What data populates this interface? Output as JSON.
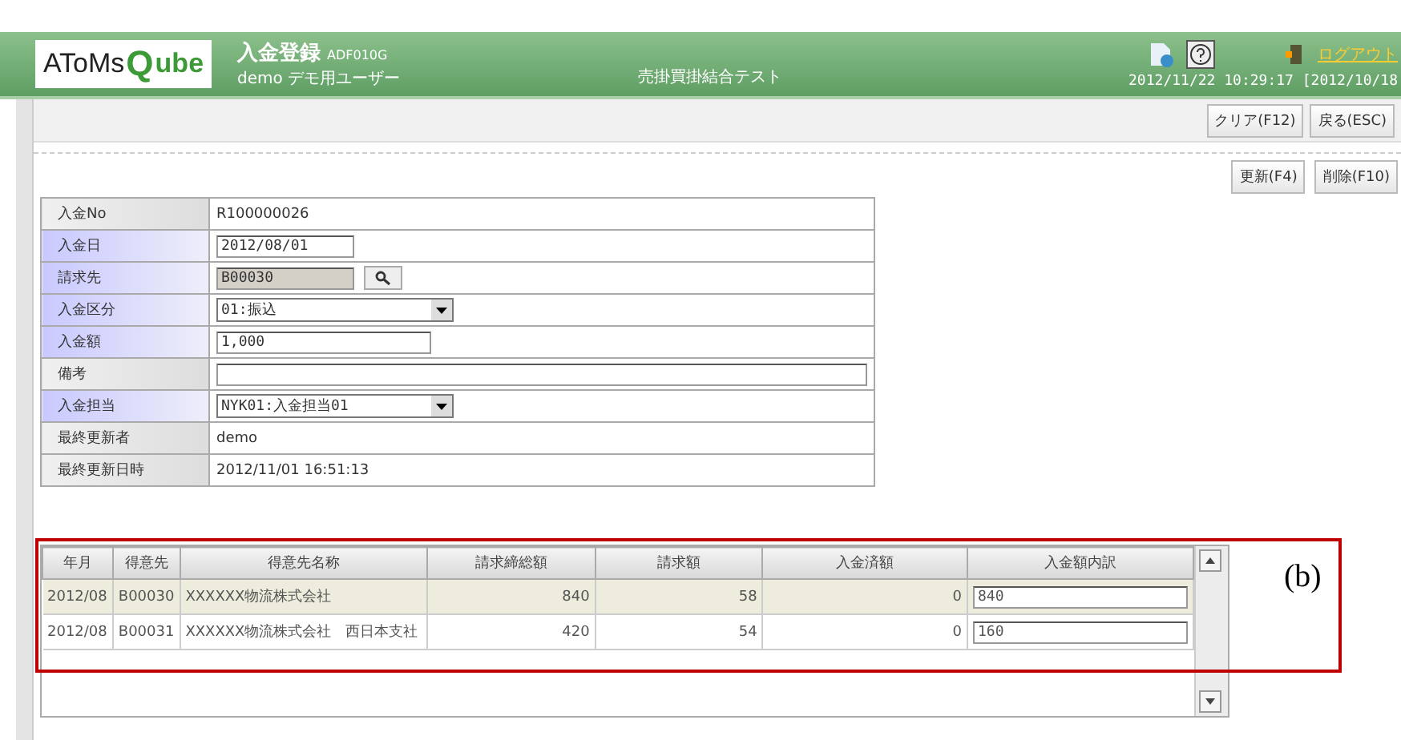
{
  "header": {
    "logo": {
      "prefix": "AToMs",
      "mark": "Q",
      "suffix": "ube"
    },
    "screen_title": "入金登録",
    "screen_id": "ADF010G",
    "user": "demo デモ用ユーザー",
    "environment": "売掛買掛結合テスト",
    "logout": "ログアウト",
    "datetime": "2012/11/22 10:29:17 [2012/10/18"
  },
  "toolbar_buttons": [
    "クリア(F12)",
    "戻る(ESC)"
  ],
  "action_buttons": [
    "更新(F4)",
    "削除(F10)"
  ],
  "form": [
    {
      "label": "入金No",
      "required": false,
      "kind": "text",
      "value": "R100000026"
    },
    {
      "label": "入金日",
      "required": true,
      "kind": "date",
      "value": "2012/08/01"
    },
    {
      "label": "請求先",
      "required": true,
      "kind": "lookup",
      "value": "B00030"
    },
    {
      "label": "入金区分",
      "required": true,
      "kind": "select",
      "value": "01:振込"
    },
    {
      "label": "入金額",
      "required": true,
      "kind": "amount",
      "value": "1,000"
    },
    {
      "label": "備考",
      "required": false,
      "kind": "memo"
    },
    {
      "label": "入金担当",
      "required": true,
      "kind": "select",
      "value": "NYK01:入金担当01"
    },
    {
      "label": "最終更新者",
      "required": false,
      "kind": "text",
      "value": "demo"
    },
    {
      "label": "最終更新日時",
      "required": false,
      "kind": "text",
      "value": "2012/11/01 16:51:13"
    }
  ],
  "grid": {
    "columns": [
      "年月",
      "得意先",
      "得意先名称",
      "請求締総額",
      "請求額",
      "入金済額",
      "入金額内訳"
    ],
    "rows": [
      {
        "selected": true,
        "cells": [
          "2012/08",
          "B00030",
          "XXXXXX物流株式会社",
          "840",
          "58",
          "0"
        ],
        "allocation": "840"
      },
      {
        "selected": false,
        "cells": [
          "2012/08",
          "B00031",
          "XXXXXX物流株式会社　西日本支社",
          "420",
          "54",
          "0"
        ],
        "allocation": "160"
      }
    ]
  },
  "annotation": {
    "label": "(b)"
  }
}
